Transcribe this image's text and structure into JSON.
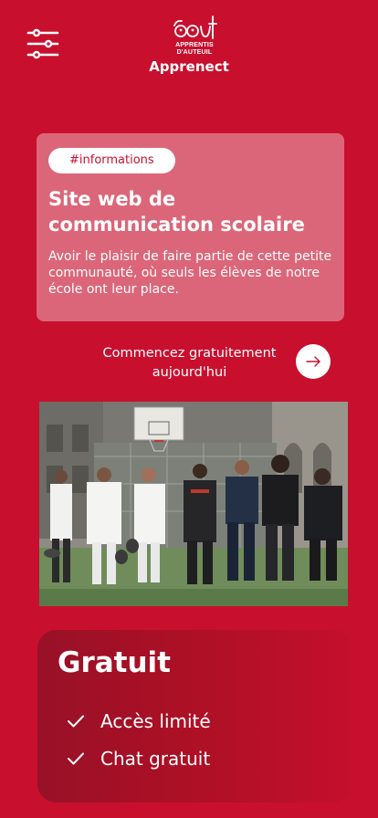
{
  "header": {
    "menu_icon": "sliders-icon",
    "logo_icon": "apprentis-d-auteuil-logo",
    "logo_line1": "APPRENTIS",
    "logo_line2": "D'AUTEUIL",
    "app_name": "Apprenect"
  },
  "info_card": {
    "tag": "#informations",
    "title": "Site web de communication scolaire",
    "description": "Avoir le plaisir de faire partie de cette petite communauté, où seuls les élèves de notre école ont leur place."
  },
  "cta": {
    "label": "Commencez gratuitement aujourd'hui",
    "icon": "arrow-right-icon"
  },
  "photo": {
    "description_icon": "students-photo"
  },
  "plan": {
    "title": "Gratuit",
    "features": [
      {
        "icon": "check-icon",
        "label": "Accès limité"
      },
      {
        "icon": "check-icon",
        "label": "Chat gratuit"
      }
    ]
  },
  "colors": {
    "brand": "#C8102E",
    "card_overlay": "rgba(255,255,255,0.36)",
    "plan_dark": "#981127"
  }
}
